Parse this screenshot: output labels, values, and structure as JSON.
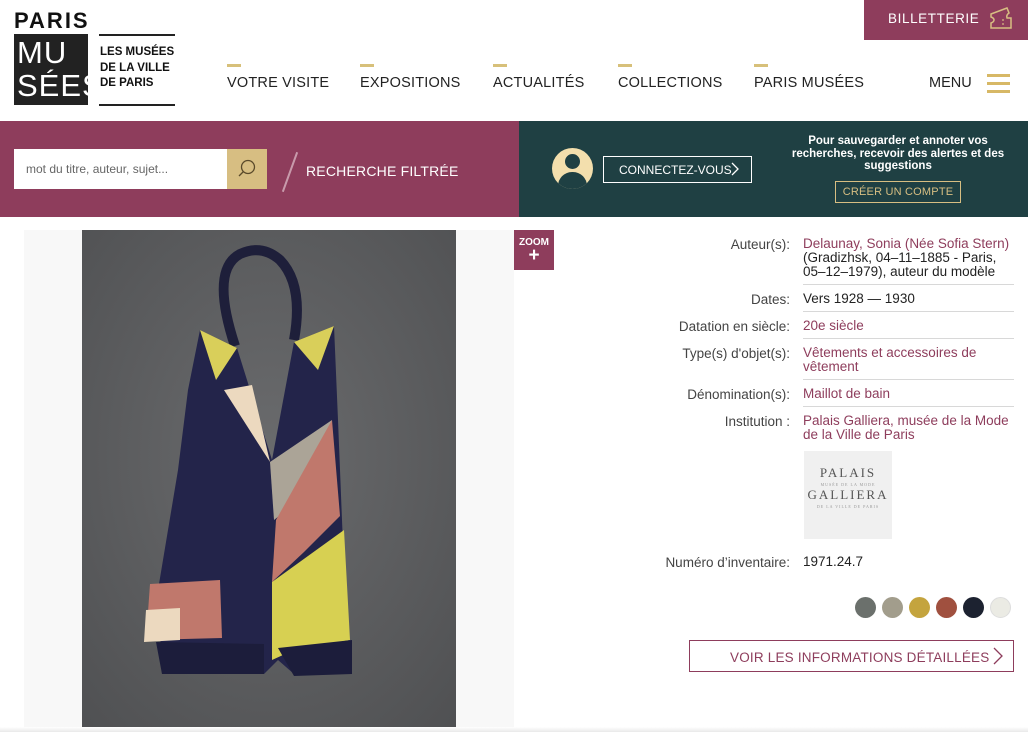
{
  "logo": {
    "paris": "PARIS",
    "box_line1": "MU",
    "box_line2": "SÉES",
    "subtitle_line1": "LES MUSÉES",
    "subtitle_line2": "DE LA VILLE",
    "subtitle_line3": "DE PARIS"
  },
  "nav": {
    "items": [
      {
        "label": "VOTRE VISITE"
      },
      {
        "label": "EXPOSITIONS"
      },
      {
        "label": "ACTUALITÉS"
      },
      {
        "label": "COLLECTIONS"
      },
      {
        "label": "PARIS MUSÉES"
      }
    ],
    "menu_label": "MENU",
    "ticket_label": "BILLETTERIE"
  },
  "search": {
    "placeholder": "mot du titre, auteur, sujet...",
    "filter_label": "RECHERCHE FILTRÉE"
  },
  "account": {
    "connect_label": "CONNECTEZ-VOUS",
    "promo_text": "Pour sauvegarder et annoter vos recherches, recevoir des alertes et des suggestions",
    "create_label": "CRÉER UN COMPTE"
  },
  "viewer": {
    "zoom_label": "ZOOM",
    "zoom_plus": "+"
  },
  "details": {
    "authors_label": "Auteur(s):",
    "authors_link": "Delaunay, Sonia (Née Sofia Stern)",
    "authors_extra": "(Gradizhsk, 04–11–1885 - Paris, 05–12–1979), auteur du modèle",
    "dates_label": "Dates:",
    "dates_value": "Vers 1928 — 1930",
    "century_label": "Datation en siècle:",
    "century_value": "20e siècle",
    "type_label": "Type(s) d'objet(s):",
    "type_value": "Vêtements et accessoires de vêtement",
    "denomination_label": "Dénomination(s):",
    "denomination_value": "Maillot de bain",
    "institution_label": "Institution :",
    "institution_value": "Palais Galliera, musée de la Mode de la Ville de Paris",
    "inventory_label": "Numéro d’inventaire:",
    "inventory_value": "1971.24.7"
  },
  "institution_logo": {
    "line1": "PALAIS",
    "line2": "MUSÉE DE LA MODE",
    "line3": "GALLIERA",
    "line4": "DE LA VILLE DE PARIS"
  },
  "swatch_colors": [
    "#6b706c",
    "#a29d8c",
    "#c4a43e",
    "#a0503f",
    "#1c2230",
    "#ebebe4"
  ],
  "colors": {
    "brand_plum": "#8e3d5c",
    "dark_teal": "#1f4043",
    "gold": "#d7be82"
  },
  "more_info_label": "VOIR LES INFORMATIONS DÉTAILLÉES"
}
